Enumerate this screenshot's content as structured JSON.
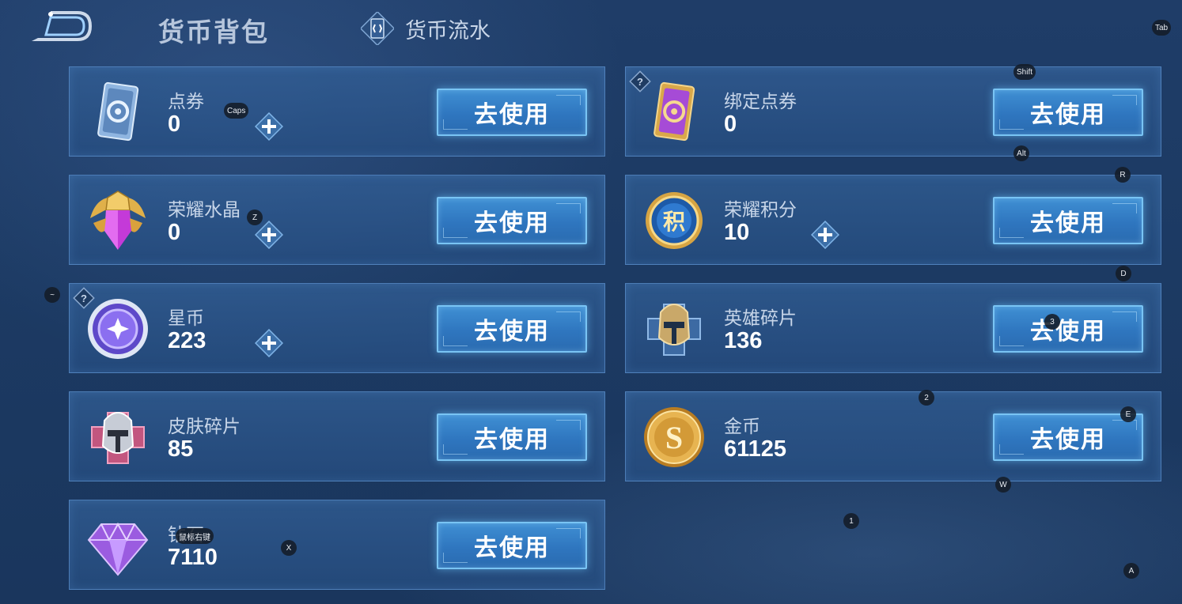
{
  "header": {
    "title": "货币背包",
    "flow_tab_label": "货币流水"
  },
  "cards": [
    {
      "id": "voucher",
      "name": "点券",
      "value": "0",
      "button_label": "去使用"
    },
    {
      "id": "bound-voucher",
      "name": "绑定点券",
      "value": "0",
      "button_label": "去使用"
    },
    {
      "id": "honor-crystal",
      "name": "荣耀水晶",
      "value": "0",
      "button_label": "去使用"
    },
    {
      "id": "honor-points",
      "name": "荣耀积分",
      "value": "10",
      "button_label": "去使用"
    },
    {
      "id": "star-coin",
      "name": "星币",
      "value": "223",
      "button_label": "去使用"
    },
    {
      "id": "hero-fragment",
      "name": "英雄碎片",
      "value": "136",
      "button_label": "去使用"
    },
    {
      "id": "skin-fragment",
      "name": "皮肤碎片",
      "value": "85",
      "button_label": "去使用"
    },
    {
      "id": "gold-coin",
      "name": "金币",
      "value": "61125",
      "button_label": "去使用"
    },
    {
      "id": "diamond",
      "name": "钻石",
      "value": "7110",
      "button_label": "去使用"
    }
  ],
  "icons": {
    "voucher": "blue-ticket-icon",
    "bound-voucher": "purple-ticket-icon",
    "honor-crystal": "honor-crystal-icon",
    "honor-points": "honor-points-medal-icon",
    "star-coin": "star-coin-icon",
    "hero-fragment": "hero-fragment-icon",
    "skin-fragment": "skin-fragment-icon",
    "gold-coin": "gold-coin-icon",
    "diamond": "diamond-icon"
  },
  "key_hints": {
    "tab": "Tab",
    "shift": "Shift",
    "alt": "Alt",
    "caps": "Caps",
    "r": "R",
    "z": "Z",
    "d": "D",
    "tilde": "~",
    "three": "3",
    "two": "2",
    "e": "E",
    "w": "W",
    "one": "1",
    "x": "X",
    "a": "A",
    "right_mouse": "鼠标右键"
  },
  "colors": {
    "background": "#1c3a63",
    "card_border": "#6ea5e6",
    "button": "#2f76bf",
    "button_border": "#79c4f4",
    "gold": "#e0b04a",
    "purple": "#a64bd6"
  }
}
